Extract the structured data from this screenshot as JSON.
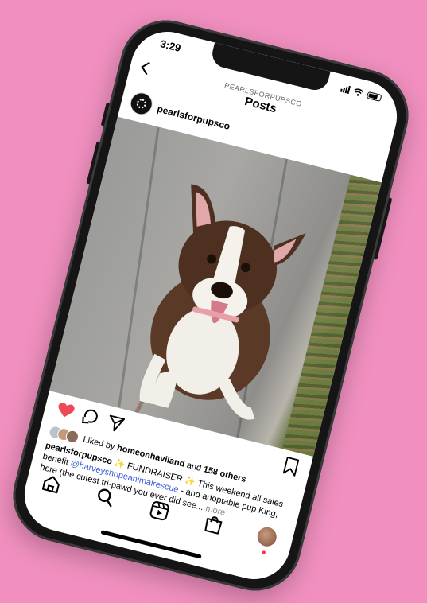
{
  "status": {
    "time": "3:29"
  },
  "nav": {
    "account_label": "PEARLSFORPUPSCO",
    "title": "Posts"
  },
  "post": {
    "username": "pearlsforpupsco",
    "more_label": "...",
    "likes": {
      "prefix": "Liked by",
      "user": "homeonhaviland",
      "joiner": "and",
      "count": "158 others"
    },
    "caption": {
      "user": "pearlsforpupsco",
      "text1": " ✨ FUNDRAISER ✨ This weekend all sales benefit ",
      "mention": "@harveyshopeanimalrescue",
      "text2": " - and adoptable pup King, here (the cutest tri-pawd you ever did see...",
      "more": "more"
    }
  },
  "tabs": [
    "home-icon",
    "search-icon",
    "reels-icon",
    "shop-icon",
    "profile-icon"
  ],
  "colors": {
    "background": "#f190c0",
    "like_red": "#ed4956",
    "mention_blue": "#3b5bd6",
    "notif_dot": "#ff3040"
  }
}
